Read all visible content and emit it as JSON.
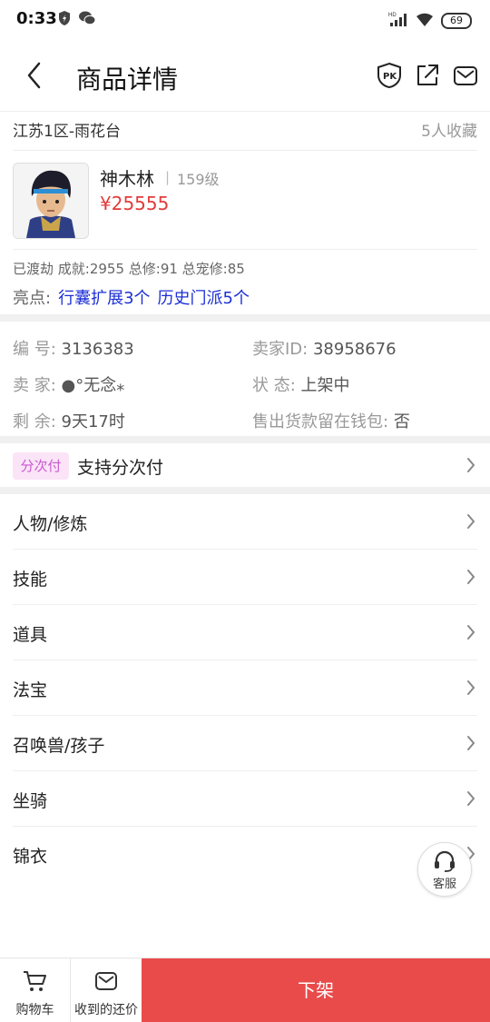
{
  "statusbar": {
    "time": "0:33",
    "battery": "69"
  },
  "header": {
    "title": "商品详情"
  },
  "product": {
    "region": "江苏1区-雨花台",
    "favorites": "5人收藏",
    "name": "神木林",
    "divider": "|",
    "level": "159级",
    "price": "¥25555",
    "stats": "已渡劫 成就:2955 总修:91 总宠修:85",
    "highlights_label": "亮点:",
    "highlights": [
      "行囊扩展3个",
      "历史门派5个"
    ]
  },
  "info": {
    "id_label": "编 号:",
    "id_value": "3136383",
    "seller_id_label": "卖家ID:",
    "seller_id_value": "38958676",
    "seller_label": "卖 家:",
    "seller_value": "●°无念⁎",
    "status_label": "状 态:",
    "status_value": "上架中",
    "remaining_label": "剩 余:",
    "remaining_value": "9天17时",
    "wallet_label": "售出货款留在钱包:",
    "wallet_value": "否"
  },
  "installment": {
    "badge": "分次付",
    "text": "支持分次付"
  },
  "menu": [
    {
      "label": "人物/修炼"
    },
    {
      "label": "技能"
    },
    {
      "label": "道具"
    },
    {
      "label": "法宝"
    },
    {
      "label": "召唤兽/孩子"
    },
    {
      "label": "坐骑"
    },
    {
      "label": "锦衣"
    }
  ],
  "customer_service": {
    "label": "客服"
  },
  "bottom": {
    "cart": "购物车",
    "offers": "收到的还价",
    "action": "下架"
  },
  "colors": {
    "price": "#e33b3b",
    "highlight": "#1c2fd6",
    "action_bg": "#e94b4b",
    "badge_bg": "#fbe4f7",
    "badge_text": "#c85ad0"
  }
}
